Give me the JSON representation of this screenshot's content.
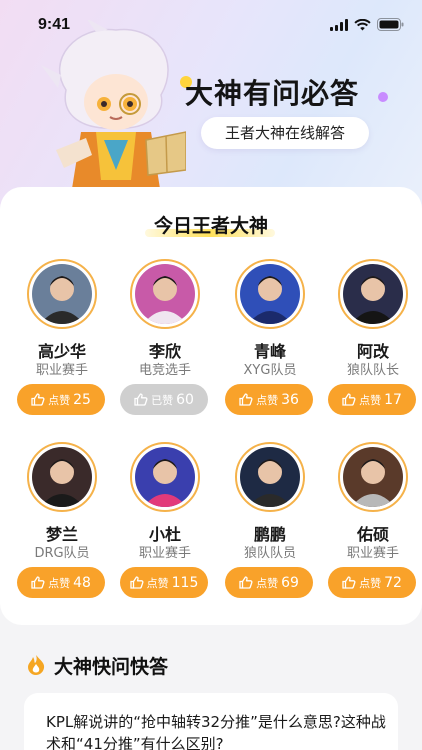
{
  "status_bar": {
    "time": "9:41"
  },
  "hero": {
    "title": "大神有问必答",
    "subtitle": "王者大神在线解答"
  },
  "experts_section": {
    "title": "今日王者大神",
    "experts": [
      {
        "name": "高少华",
        "role": "职业赛手",
        "like_label": "点赞",
        "likes": "25",
        "liked": false,
        "avatar_bg": "#6a7f9a",
        "avatar_shirt": "#2a2a2a"
      },
      {
        "name": "李欣",
        "role": "电竞选手",
        "like_label": "已赞",
        "likes": "60",
        "liked": true,
        "avatar_bg": "#c85aa8",
        "avatar_shirt": "#f0e6f0"
      },
      {
        "name": "青峰",
        "role": "XYG队员",
        "like_label": "点赞",
        "likes": "36",
        "liked": false,
        "avatar_bg": "#2f4fb8",
        "avatar_shirt": "#1b2a6b"
      },
      {
        "name": "阿改",
        "role": "狼队队长",
        "like_label": "点赞",
        "likes": "17",
        "liked": false,
        "avatar_bg": "#2a2d4a",
        "avatar_shirt": "#151515"
      },
      {
        "name": "梦兰",
        "role": "DRG队员",
        "like_label": "点赞",
        "likes": "48",
        "liked": false,
        "avatar_bg": "#3a2a2a",
        "avatar_shirt": "#1a1a1a"
      },
      {
        "name": "小杜",
        "role": "职业赛手",
        "like_label": "点赞",
        "likes": "115",
        "liked": false,
        "avatar_bg": "#3a3fae",
        "avatar_shirt": "#e23a7a"
      },
      {
        "name": "鹏鹏",
        "role": "狼队队员",
        "like_label": "点赞",
        "likes": "69",
        "liked": false,
        "avatar_bg": "#1e2a44",
        "avatar_shirt": "#2a2a2a"
      },
      {
        "name": "佑硕",
        "role": "职业赛手",
        "like_label": "点赞",
        "likes": "72",
        "liked": false,
        "avatar_bg": "#5a3a2a",
        "avatar_shirt": "#b8b8b8"
      }
    ]
  },
  "qa_section": {
    "title": "大神快问快答",
    "question": "KPL解说讲的“抢中轴转32分推”是什么意思?这种战术和“41分推”有什么区别?"
  },
  "colors": {
    "accent": "#f9a22a",
    "liked": "#cfcfcf",
    "avatar_ring": "#f5b24a",
    "title_underline": "#ffe15a"
  },
  "icons": {
    "like": "thumbs-up-icon",
    "qa": "flame-icon"
  }
}
